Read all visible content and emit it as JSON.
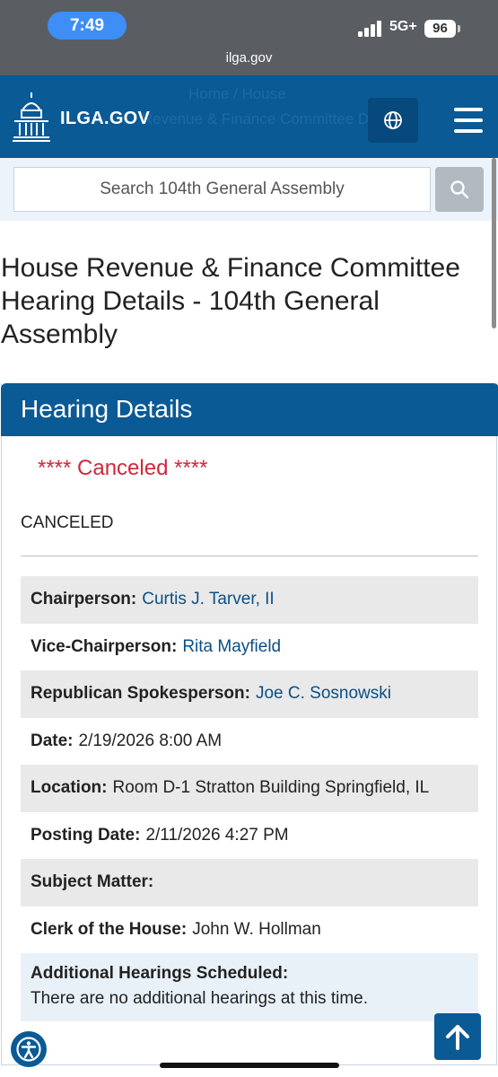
{
  "status": {
    "time": "7:49",
    "network": "5G+",
    "battery": "96"
  },
  "browser": {
    "url": "ilga.gov"
  },
  "header": {
    "logo_text": "ILGA.GOV",
    "ghost_breadcrumb": "Home   /   House",
    "ghost_title": "Revenue & Finance Committee De"
  },
  "search": {
    "placeholder": "Search 104th General Assembly"
  },
  "page": {
    "title": "House Revenue & Finance Committee Hearing Details - 104th General Assembly"
  },
  "hearing": {
    "heading": "Hearing Details",
    "status_banner": "**** Canceled ****",
    "status_text": "CANCELED",
    "chairperson_label": "Chairperson:",
    "chairperson": "Curtis J. Tarver, II",
    "vice_chair_label": "Vice-Chairperson:",
    "vice_chair": "Rita Mayfield",
    "rep_spokes_label": "Republican Spokesperson:",
    "rep_spokes": "Joe C. Sosnowski",
    "date_label": "Date:",
    "date": "2/19/2026 8:00 AM",
    "location_label": "Location:",
    "location": "Room D-1 Stratton Building Springfield, IL",
    "posting_label": "Posting Date:",
    "posting_date": "2/11/2026 4:27 PM",
    "subject_label": "Subject Matter:",
    "subject": "",
    "clerk_label": "Clerk of the House:",
    "clerk": "John W. Hollman",
    "additional_label": "Additional Hearings Scheduled:",
    "additional": "There are no additional hearings at this time."
  },
  "colors": {
    "brand_blue": "#0a5a96",
    "canceled_red": "#d0273c",
    "link_blue": "#0b4f85"
  }
}
